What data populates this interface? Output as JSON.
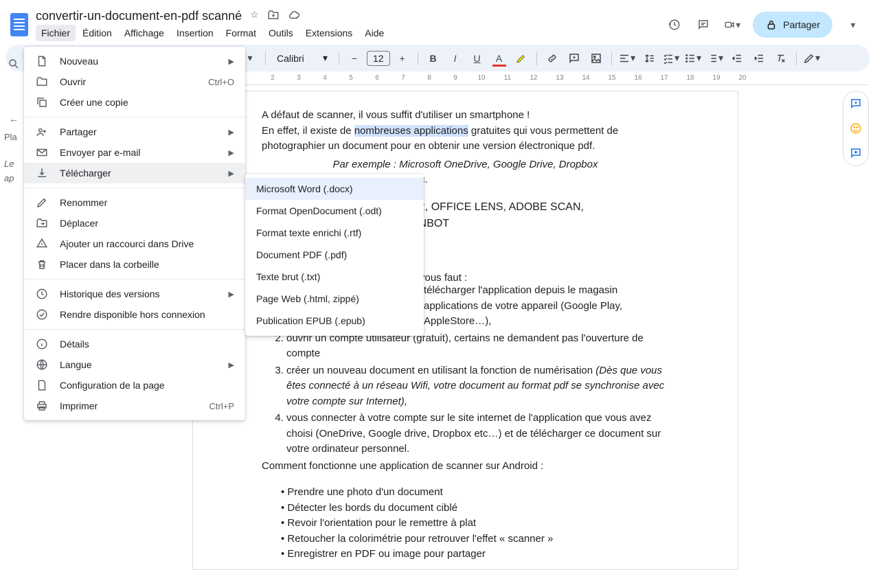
{
  "doc_title": "convertir-un-document-en-pdf scanné",
  "menubar": [
    "Fichier",
    "Édition",
    "Affichage",
    "Insertion",
    "Format",
    "Outils",
    "Extensions",
    "Aide"
  ],
  "share_label": "Partager",
  "toolbar": {
    "font": "Calibri",
    "size": "12"
  },
  "ruler": [
    "2",
    "3",
    "4",
    "5",
    "6",
    "7",
    "8",
    "9",
    "10",
    "11",
    "12",
    "13",
    "14",
    "15",
    "16",
    "17",
    "18",
    "19",
    "20"
  ],
  "left_panel": {
    "heading": "Pla",
    "l1": "Le",
    "l2": "ap"
  },
  "file_menu": {
    "nouveau": "Nouveau",
    "ouvrir": "Ouvrir",
    "ouvrir_sc": "Ctrl+O",
    "copie": "Créer une copie",
    "partager": "Partager",
    "email": "Envoyer par e-mail",
    "telecharger": "Télécharger",
    "renommer": "Renommer",
    "deplacer": "Déplacer",
    "raccourci": "Ajouter un raccourci dans Drive",
    "corbeille": "Placer dans la corbeille",
    "historique": "Historique des versions",
    "hors_connexion": "Rendre disponible hors connexion",
    "details": "Détails",
    "langue": "Langue",
    "config": "Configuration de la page",
    "imprimer": "Imprimer",
    "imprimer_sc": "Ctrl+P"
  },
  "download_submenu": [
    "Microsoft Word (.docx)",
    "Format OpenDocument (.odt)",
    "Format texte enrichi (.rtf)",
    "Document PDF (.pdf)",
    "Texte brut (.txt)",
    "Page Web (.html, zippé)",
    "Publication EPUB (.epub)"
  ],
  "doc": {
    "p1a": "A défaut de scanner, il vous suffit d'utiliser un smartphone !",
    "p2a": "En effet, il existe de ",
    "p2sel": "nombreuses applications",
    "p2b": " gratuites qui vous permettent de photographier un document pour en obtenir une version électronique pdf.",
    "p3": "Par exemple : Microsoft OneDrive, Google Drive, Dropbox",
    "p3b": "c.",
    "apps": "CAMSCANNER, OFFICE LENS, ADOBE SCAN,",
    "apps2": "ANBOT",
    "p4": "vous faut :",
    "li1": "télécharger l'application depuis le magasin applications de votre appareil (Google Play, AppleStore…),",
    "li2a": "ouvrir un compte utilisateur (gratuit), ",
    "li2b": "certains ne demandent pas l'ouverture de compte",
    "li3a": "créer un nouveau document en utilisant la fonction de numérisation ",
    "li3b": "(Dès que vous êtes connecté à un réseau Wifi, votre document au format pdf se synchronise avec votre compte sur Internet),",
    "li4": "vous connecter à votre compte sur le site internet de l'application que vous avez choisi (OneDrive, Google drive, Dropbox etc…) et de télécharger ce document sur  votre ordinateur personnel.",
    "h2": "Comment fonctionne une application de scanner sur Android :",
    "b1": "Prendre une photo d'un document",
    "b2": "Détecter les bords du document ciblé",
    "b3": "Revoir l'orientation pour le remettre à plat",
    "b4": "Retoucher la colorimétrie pour retrouver l'effet « scanner »",
    "b5": "Enregistrer en PDF ou image pour partager"
  }
}
